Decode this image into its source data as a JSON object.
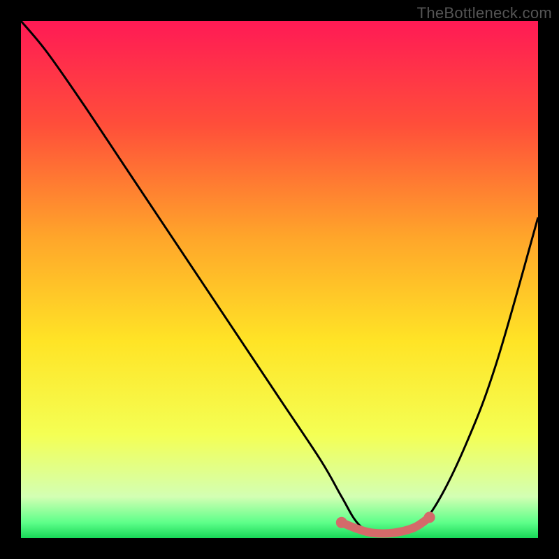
{
  "watermark": "TheBottleneck.com",
  "chart_data": {
    "type": "line",
    "title": "",
    "xlabel": "",
    "ylabel": "",
    "xlim": [
      0,
      100
    ],
    "ylim": [
      0,
      100
    ],
    "gradient_stops": [
      {
        "offset": 0,
        "color": "#ff1a55"
      },
      {
        "offset": 20,
        "color": "#ff4e3a"
      },
      {
        "offset": 42,
        "color": "#ffa62a"
      },
      {
        "offset": 62,
        "color": "#ffe426"
      },
      {
        "offset": 80,
        "color": "#f4ff54"
      },
      {
        "offset": 92,
        "color": "#d3ffb3"
      },
      {
        "offset": 97,
        "color": "#5eff8a"
      },
      {
        "offset": 100,
        "color": "#18d858"
      }
    ],
    "series": [
      {
        "name": "bottleneck-curve",
        "color": "#000000",
        "x": [
          0,
          5,
          12,
          20,
          30,
          40,
          50,
          58,
          62,
          65,
          68,
          72,
          76,
          80,
          86,
          92,
          100
        ],
        "y": [
          100,
          94,
          84,
          72,
          57,
          42,
          27,
          15,
          8,
          3,
          1,
          1,
          2,
          6,
          18,
          34,
          62
        ]
      }
    ],
    "optimal_zone": {
      "name": "optimal-segment",
      "color": "#d46a6a",
      "x": [
        62,
        65,
        68,
        72,
        76,
        79
      ],
      "y": [
        3,
        1.8,
        1,
        1,
        2,
        4
      ]
    }
  }
}
